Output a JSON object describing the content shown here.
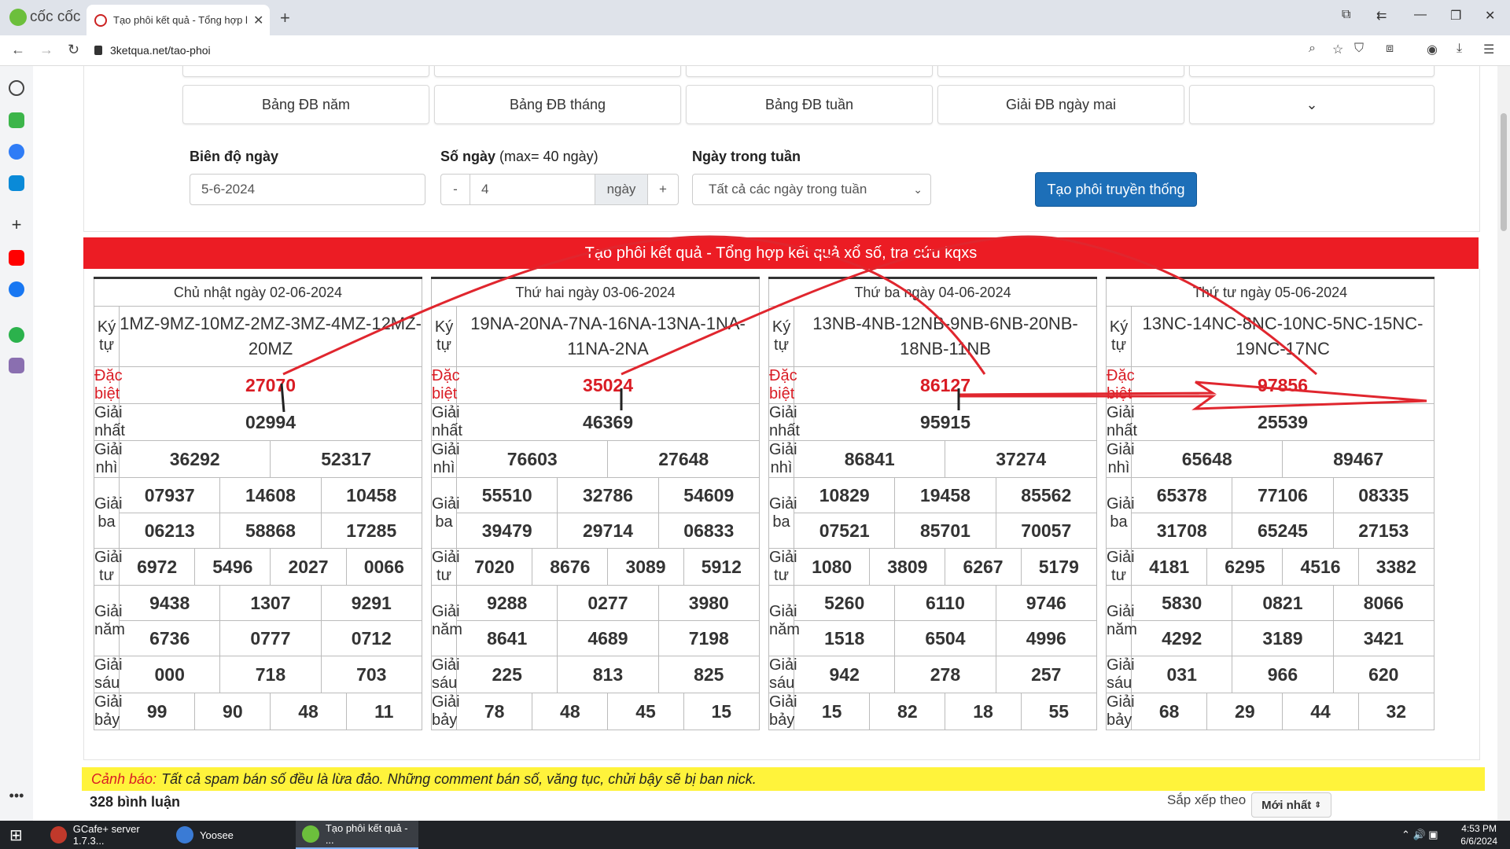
{
  "browser": {
    "brand": "cốc cốc",
    "tab_title": "Tạo phôi kết quả - Tổng hợp kết quả",
    "url": "3ketqua.net/tao-phoi"
  },
  "quick_buttons": [
    "Bảng ĐB năm",
    "Bảng ĐB tháng",
    "Bảng ĐB tuần",
    "Giải ĐB ngày mai"
  ],
  "form": {
    "date_label": "Biên độ ngày",
    "date_value": "5-6-2024",
    "days_label": "Số ngày",
    "days_hint": "(max= 40 ngày)",
    "minus": "-",
    "days_value": "4",
    "days_unit": "ngày",
    "plus": "+",
    "weekday_label": "Ngày trong tuần",
    "weekday_value": "Tất cả các ngày trong tuần",
    "submit": "Tạo phôi truyền thống"
  },
  "banner": "Tạo phôi kết quả - Tổng hợp kết quả xổ số, tra cứu kqxs",
  "labels": {
    "kytu": "Ký tự",
    "db": "Đặc biệt",
    "g1": "Giải nhất",
    "g2": "Giải nhì",
    "g3": "Giải ba",
    "g4": "Giải tư",
    "g5": "Giải năm",
    "g6": "Giải sáu",
    "g7": "Giải bảy"
  },
  "results": [
    {
      "date": "Chủ nhật ngày 02-06-2024",
      "kytu": "1MZ-9MZ-10MZ-2MZ-3MZ-4MZ-12MZ-20MZ",
      "db": "27070",
      "g1": "02994",
      "g2": [
        "36292",
        "52317"
      ],
      "g3": [
        "07937",
        "14608",
        "10458",
        "06213",
        "58868",
        "17285"
      ],
      "g4": [
        "6972",
        "5496",
        "2027",
        "0066"
      ],
      "g5": [
        "9438",
        "1307",
        "9291",
        "6736",
        "0777",
        "0712"
      ],
      "g6": [
        "000",
        "718",
        "703"
      ],
      "g7": [
        "99",
        "90",
        "48",
        "11"
      ]
    },
    {
      "date": "Thứ hai ngày 03-06-2024",
      "kytu": "19NA-20NA-7NA-16NA-13NA-1NA-11NA-2NA",
      "db": "35024",
      "g1": "46369",
      "g2": [
        "76603",
        "27648"
      ],
      "g3": [
        "55510",
        "32786",
        "54609",
        "39479",
        "29714",
        "06833"
      ],
      "g4": [
        "7020",
        "8676",
        "3089",
        "5912"
      ],
      "g5": [
        "9288",
        "0277",
        "3980",
        "8641",
        "4689",
        "7198"
      ],
      "g6": [
        "225",
        "813",
        "825"
      ],
      "g7": [
        "78",
        "48",
        "45",
        "15"
      ]
    },
    {
      "date": "Thứ ba ngày 04-06-2024",
      "kytu": "13NB-4NB-12NB-9NB-6NB-20NB-18NB-11NB",
      "db": "86127",
      "g1": "95915",
      "g2": [
        "86841",
        "37274"
      ],
      "g3": [
        "10829",
        "19458",
        "85562",
        "07521",
        "85701",
        "70057"
      ],
      "g4": [
        "1080",
        "3809",
        "6267",
        "5179"
      ],
      "g5": [
        "5260",
        "6110",
        "9746",
        "1518",
        "6504",
        "4996"
      ],
      "g6": [
        "942",
        "278",
        "257"
      ],
      "g7": [
        "15",
        "82",
        "18",
        "55"
      ]
    },
    {
      "date": "Thứ tư ngày 05-06-2024",
      "kytu": "13NC-14NC-8NC-10NC-5NC-15NC-19NC-17NC",
      "db": "97856",
      "g1": "25539",
      "g2": [
        "65648",
        "89467"
      ],
      "g3": [
        "65378",
        "77106",
        "08335",
        "31708",
        "65245",
        "27153"
      ],
      "g4": [
        "4181",
        "6295",
        "4516",
        "3382"
      ],
      "g5": [
        "5830",
        "0821",
        "8066",
        "4292",
        "3189",
        "3421"
      ],
      "g6": [
        "031",
        "966",
        "620"
      ],
      "g7": [
        "68",
        "29",
        "44",
        "32"
      ]
    }
  ],
  "warning": {
    "prefix": "Cảnh báo:",
    "text": "Tất cả spam bán số đều là lừa đảo. Những comment bán số, văng tục, chửi bậy sẽ bị ban nick."
  },
  "comments": {
    "count": "328 bình luận",
    "sort_label": "Sắp xếp theo",
    "sort_value": "Mới nhất"
  },
  "taskbar": {
    "items": [
      "GCafe+ server 1.7.3...",
      "Yoosee",
      "Tạo phôi kết quả - ..."
    ],
    "time": "4:53 PM",
    "date": "6/6/2024"
  },
  "colors": {
    "red": "#ec1c24",
    "blue": "#1d6fb8",
    "warn": "#fff33b"
  }
}
